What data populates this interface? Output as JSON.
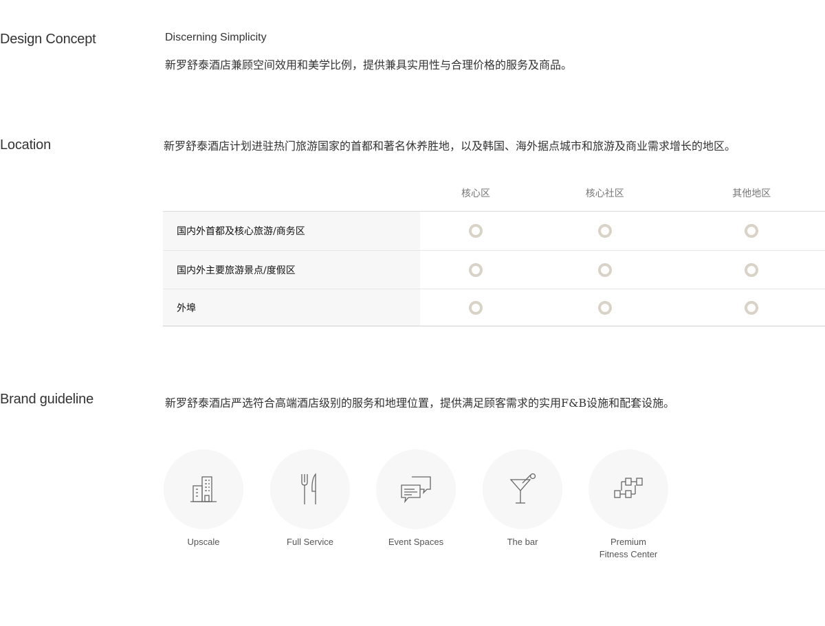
{
  "design_concept": {
    "label": "Design Concept",
    "subtitle": "Discerning Simplicity",
    "text": "新罗舒泰酒店兼顾空间效用和美学比例，提供兼具实用性与合理价格的服务及商品。"
  },
  "location": {
    "label": "Location",
    "text": "新罗舒泰酒店计划进驻热门旅游国家的首都和著名休养胜地，以及韩国、海外据点城市和旅游及商业需求增长的地区。",
    "columns": [
      "核心区",
      "核心社区",
      "其他地区"
    ],
    "rows": [
      {
        "name": "国内外首都及核心旅游/商务区",
        "marks": [
          true,
          true,
          true
        ]
      },
      {
        "name": "国内外主要旅游景点/度假区",
        "marks": [
          true,
          true,
          true
        ]
      },
      {
        "name": "外埠",
        "marks": [
          true,
          true,
          true
        ]
      }
    ],
    "mark_color": "#d9d2c6"
  },
  "brand_guideline": {
    "label": "Brand guideline",
    "text": "新罗舒泰酒店严选符合高端酒店级别的服务和地理位置，提供满足顾客需求的实用F&B设施和配套设施。",
    "features": [
      {
        "icon": "building-icon",
        "label_line1": "Upscale",
        "label_line2": ""
      },
      {
        "icon": "fork-knife-icon",
        "label_line1": "Full Service",
        "label_line2": ""
      },
      {
        "icon": "chat-bubbles-icon",
        "label_line1": "Event Spaces",
        "label_line2": ""
      },
      {
        "icon": "cocktail-glass-icon",
        "label_line1": "The bar",
        "label_line2": ""
      },
      {
        "icon": "dumbbell-icon",
        "label_line1": "Premium",
        "label_line2": "Fitness Center"
      }
    ]
  }
}
